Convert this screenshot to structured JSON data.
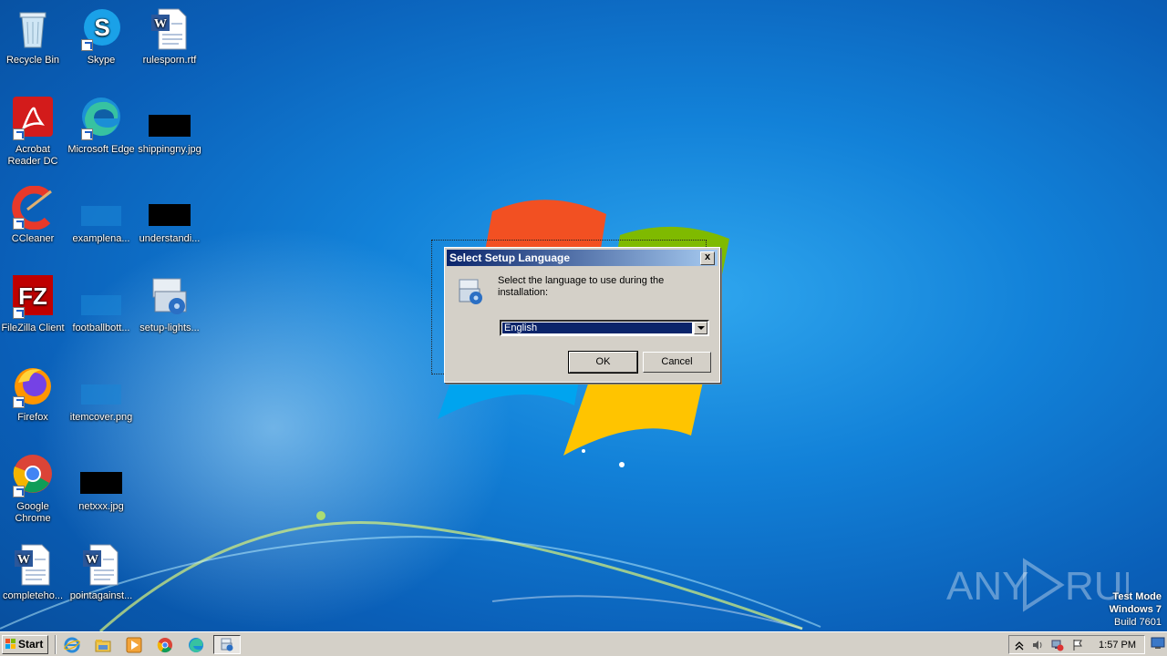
{
  "desktop_icons": [
    {
      "label": "Recycle Bin",
      "icon": "recycle-bin-icon"
    },
    {
      "label": "Skype",
      "icon": "skype-icon"
    },
    {
      "label": "rulesporn.rtf",
      "icon": "word-document-icon"
    },
    {
      "label": "Acrobat Reader DC",
      "icon": "acrobat-reader-icon"
    },
    {
      "label": "Microsoft Edge",
      "icon": "edge-icon"
    },
    {
      "label": "shippingny.jpg",
      "icon": "image-file-icon"
    },
    {
      "label": "CCleaner",
      "icon": "ccleaner-icon"
    },
    {
      "label": "examplena...",
      "icon": "image-file-icon"
    },
    {
      "label": "understandi...",
      "icon": "image-file-icon"
    },
    {
      "label": "FileZilla Client",
      "icon": "filezilla-icon"
    },
    {
      "label": "footballbott...",
      "icon": "image-file-icon"
    },
    {
      "label": "setup-lights...",
      "icon": "setup-installer-icon"
    },
    {
      "label": "Firefox",
      "icon": "firefox-icon"
    },
    {
      "label": "itemcover.png",
      "icon": "image-file-icon"
    },
    {
      "label": "Google Chrome",
      "icon": "chrome-icon"
    },
    {
      "label": "netxxx.jpg",
      "icon": "image-file-icon"
    },
    {
      "label": "completeho...",
      "icon": "word-document-icon"
    },
    {
      "label": "pointagainst...",
      "icon": "word-document-icon"
    }
  ],
  "dialog": {
    "title": "Select Setup Language",
    "close_label": "x",
    "prompt": "Select the language to use during the installation:",
    "language_selected": "English",
    "ok_label": "OK",
    "cancel_label": "Cancel"
  },
  "taskbar": {
    "start_label": "Start",
    "clock": "1:57 PM"
  },
  "watermark": {
    "brand": "ANY RUN",
    "line1": "Test Mode",
    "line2": "Windows 7",
    "line3": "Build 7601"
  },
  "colors": {
    "titlebar_start": "#0a246a",
    "titlebar_end": "#a6caf0",
    "dialog_face": "#d4d0c8",
    "desktop_blue": "#1281d8"
  }
}
